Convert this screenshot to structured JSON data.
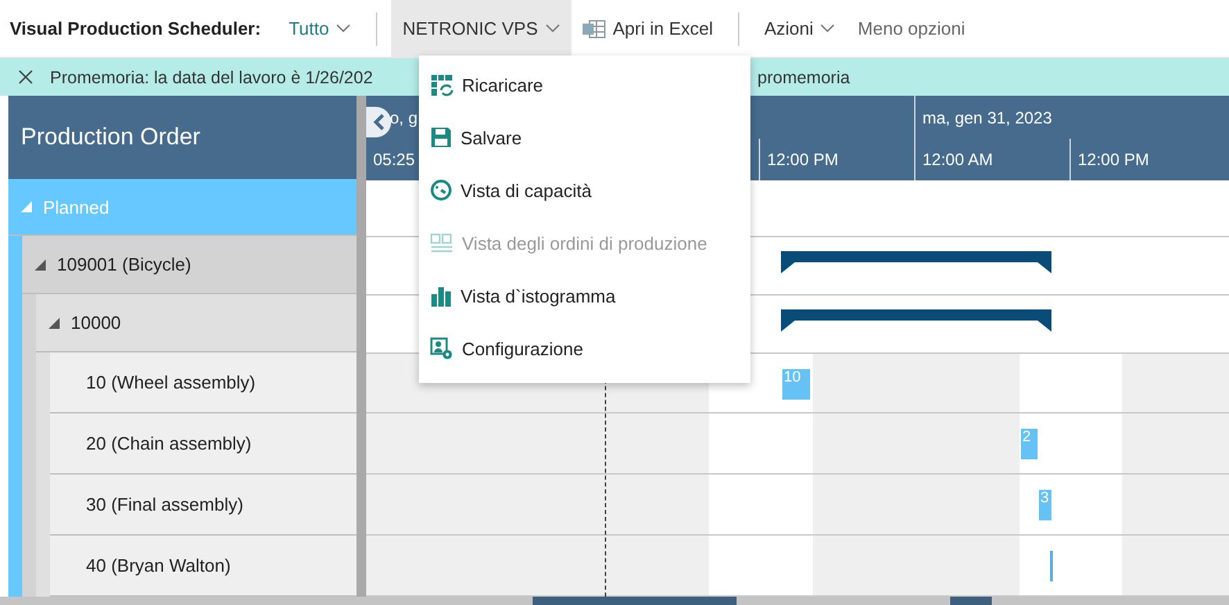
{
  "toolbar": {
    "title": "Visual Production Scheduler:",
    "items": [
      {
        "label": "Tutto",
        "kind": "filter",
        "caret": true,
        "selected": false
      },
      {
        "label": "NETRONIC VPS",
        "kind": "menu",
        "caret": true,
        "selected": true
      },
      {
        "label": "Apri in Excel",
        "kind": "excel",
        "caret": false,
        "selected": false
      },
      {
        "label": "Azioni",
        "kind": "menu",
        "caret": true,
        "selected": false
      },
      {
        "label": "Meno opzioni",
        "kind": "plain",
        "caret": false,
        "selected": false
      }
    ]
  },
  "banner": {
    "text": "Promemoria: la data del lavoro è 1/26/202",
    "text_end": "promemoria"
  },
  "menu": [
    {
      "label": "Ricaricare",
      "disabled": false
    },
    {
      "label": "Salvare",
      "disabled": false
    },
    {
      "label": "Vista di capacità",
      "disabled": false
    },
    {
      "label": "Vista degli ordini di produzione",
      "disabled": true
    },
    {
      "label": "Vista d`istogramma",
      "disabled": false
    },
    {
      "label": "Configurazione",
      "disabled": false
    }
  ],
  "panel": {
    "header": "Production Order"
  },
  "timescale": {
    "dates": [
      "o, g",
      "ma, gen 31, 2023"
    ],
    "ticks": [
      "05:25",
      "12:00 PM",
      "12:00 AM",
      "12:00 PM"
    ]
  },
  "tree": [
    {
      "label": "Planned",
      "expanded": true,
      "children": [
        {
          "label": "109001 (Bicycle)",
          "expanded": true,
          "bar": {
            "kind": "summary"
          },
          "children": [
            {
              "label": "10000",
              "expanded": true,
              "bar": {
                "kind": "summary"
              },
              "children": [
                {
                  "label": "10 (Wheel assembly)",
                  "bar": {
                    "kind": "operation",
                    "label": "10"
                  }
                },
                {
                  "label": "20 (Chain assembly)",
                  "bar": {
                    "kind": "operation",
                    "label": "2"
                  }
                },
                {
                  "label": "30 (Final assembly)",
                  "bar": {
                    "kind": "operation",
                    "label": "3"
                  }
                },
                {
                  "label": "40 (Bryan Walton)",
                  "bar": {
                    "kind": "operation"
                  }
                }
              ]
            }
          ]
        }
      ]
    }
  ]
}
